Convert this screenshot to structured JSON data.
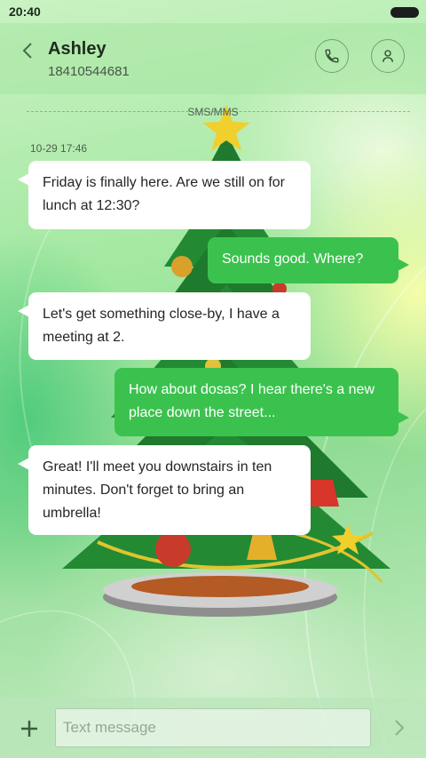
{
  "status_bar": {
    "time": "20:40",
    "battery_icon": "battery-full-icon"
  },
  "header": {
    "back_icon": "chevron-left-icon",
    "contact_name": "Ashley",
    "contact_number": "18410544681",
    "call_icon": "phone-icon",
    "profile_icon": "person-icon"
  },
  "conversation": {
    "channel_label": "SMS/MMS",
    "timestamp": "10-29 17:46",
    "messages": [
      {
        "direction": "incoming",
        "text": "Friday is finally here. Are we still on for lunch at 12:30?"
      },
      {
        "direction": "outgoing",
        "text": "Sounds good. Where?"
      },
      {
        "direction": "incoming",
        "text": "Let's get something close-by, I have a meeting at 2."
      },
      {
        "direction": "outgoing",
        "text": "How about dosas? I hear there's a new place down the street..."
      },
      {
        "direction": "incoming",
        "text": "Great! I'll meet you downstairs in ten minutes. Don't forget to bring an umbrella!"
      }
    ]
  },
  "composer": {
    "add_icon": "plus-icon",
    "placeholder": "Text message",
    "value": "",
    "send_icon": "chevron-right-icon"
  },
  "theme": {
    "outgoing_bubble": "#3bc24e",
    "incoming_bubble": "#ffffff",
    "background_tint": "#a3e8a1"
  }
}
